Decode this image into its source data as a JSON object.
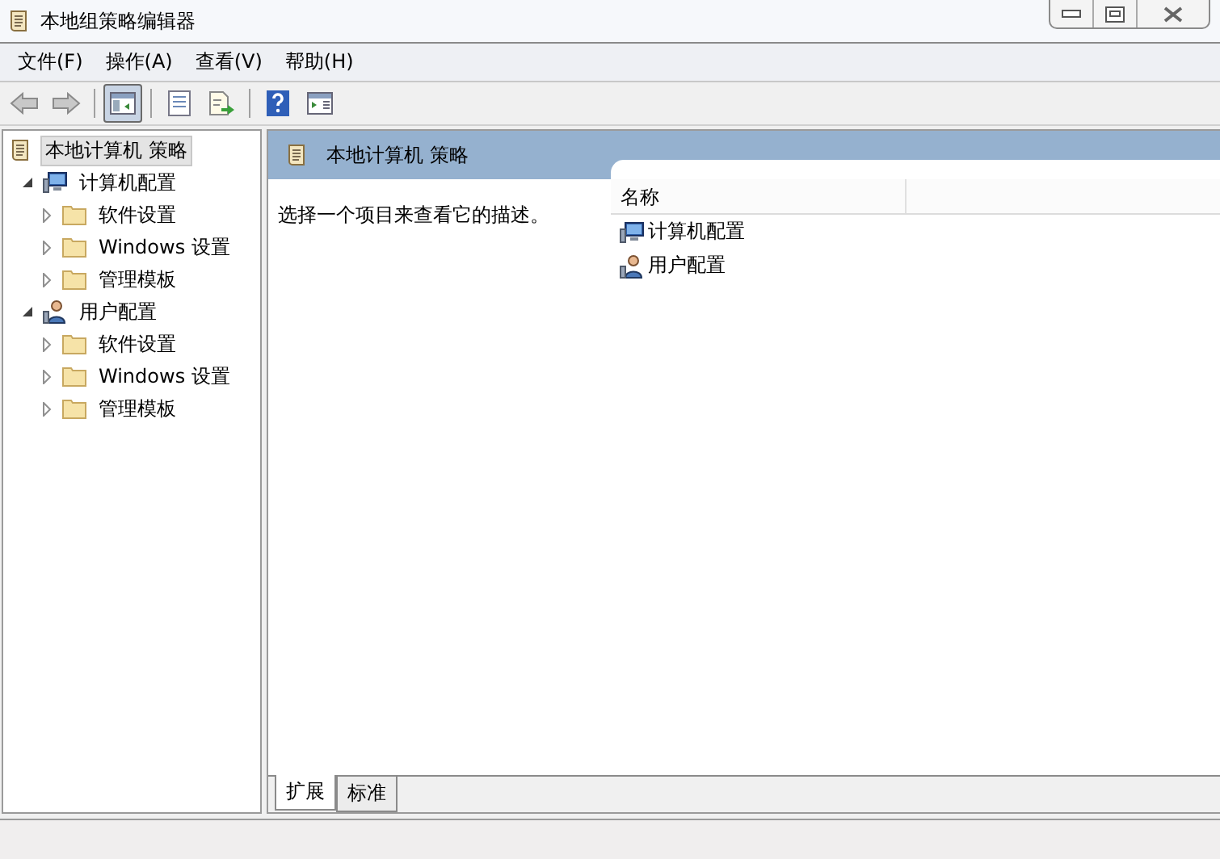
{
  "window": {
    "title": "本地组策略编辑器"
  },
  "menu": [
    "文件(F)",
    "操作(A)",
    "查看(V)",
    "帮助(H)"
  ],
  "toolbar": [
    [
      {
        "kind": "back",
        "pressed": false
      },
      {
        "kind": "forward",
        "pressed": false
      }
    ],
    [
      {
        "kind": "tree-toggle",
        "pressed": true
      }
    ],
    [
      {
        "kind": "properties",
        "pressed": false
      },
      {
        "kind": "export",
        "pressed": false
      }
    ],
    [
      {
        "kind": "help",
        "pressed": false
      },
      {
        "kind": "action-pane",
        "pressed": false
      }
    ]
  ],
  "tree": [
    {
      "label": "本地计算机 策略",
      "kind": "policy",
      "selected": true,
      "children": [
        {
          "label": "计算机配置",
          "kind": "computer",
          "selected": false,
          "expanded": true,
          "children": [
            {
              "label": "软件设置",
              "kind": "folder",
              "selected": false,
              "expanded": false
            },
            {
              "label": "Windows 设置",
              "kind": "folder",
              "selected": false,
              "expanded": false
            },
            {
              "label": "管理模板",
              "kind": "folder",
              "selected": false,
              "expanded": false
            }
          ]
        },
        {
          "label": "用户配置",
          "kind": "user",
          "selected": false,
          "expanded": true,
          "children": [
            {
              "label": "软件设置",
              "kind": "folder",
              "selected": false,
              "expanded": false
            },
            {
              "label": "Windows 设置",
              "kind": "folder",
              "selected": false,
              "expanded": false
            },
            {
              "label": "管理模板",
              "kind": "folder",
              "selected": false,
              "expanded": false
            }
          ]
        }
      ]
    }
  ],
  "details": {
    "title": "本地计算机 策略",
    "description": "选择一个项目来查看它的描述。",
    "columns": [
      "名称"
    ],
    "rows": [
      {
        "name": "计算机配置",
        "kind": "computer"
      },
      {
        "name": "用户配置",
        "kind": "user"
      }
    ]
  },
  "tabs": [
    {
      "label": "扩展",
      "selected": true
    },
    {
      "label": "标准",
      "selected": false
    }
  ]
}
